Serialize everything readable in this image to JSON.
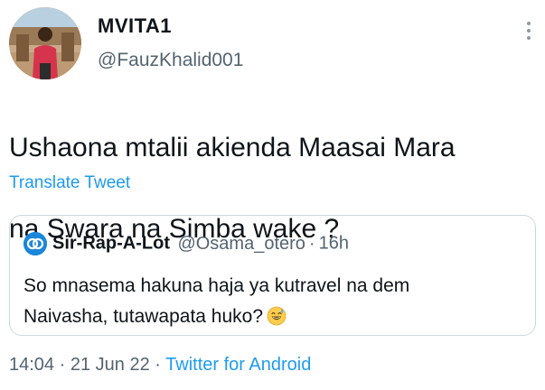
{
  "tweet": {
    "author": {
      "display_name": "MVITA1",
      "handle": "@FauzKhalid001"
    },
    "text_line1": "Ushaona mtalii akienda Maasai Mara",
    "text_line2": "na Swara na Simba  wake ?",
    "translate_label": "Translate Tweet",
    "quoted": {
      "display_name": "Sir-Rap-A-Lot",
      "handle": "@Osama_otero",
      "separator": "·",
      "time": "16h",
      "text_line1": "So mnasema hakuna haja ya kutravel na dem",
      "text_line2": "Naivasha, tutawapata huko?",
      "emoji": "grinning-sweat-face"
    },
    "meta": {
      "time": "14:04",
      "sep1": "·",
      "date": "21 Jun 22",
      "sep2": "·",
      "source": "Twitter for Android"
    }
  },
  "colors": {
    "primary_text": "#0f1419",
    "secondary_text": "#536471",
    "link": "#1d9bf0",
    "border": "#cfd9de"
  }
}
